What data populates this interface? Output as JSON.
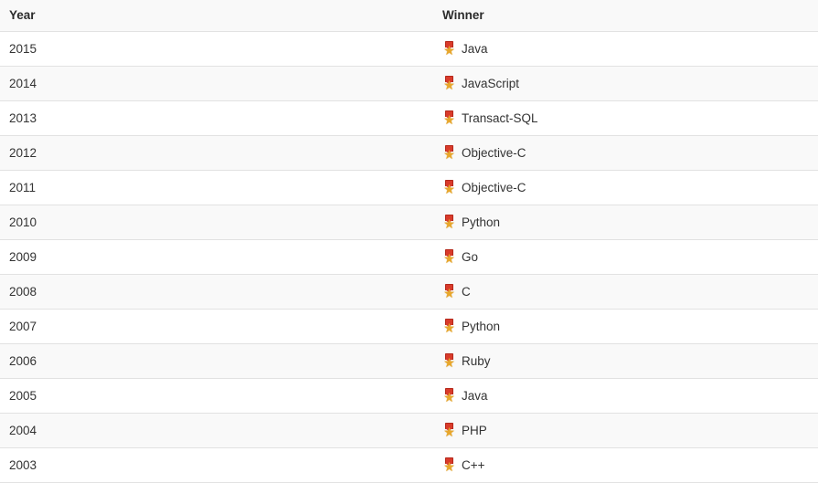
{
  "table": {
    "columns": [
      {
        "key": "year",
        "label": "Year"
      },
      {
        "key": "winner",
        "label": "Winner"
      }
    ],
    "icon": {
      "name": "sports-medal-icon",
      "glyph": "★",
      "ribbon_color": "#d93b2b",
      "medal_color": "#e8a72c"
    },
    "rows": [
      {
        "year": "2015",
        "winner": "Java"
      },
      {
        "year": "2014",
        "winner": "JavaScript"
      },
      {
        "year": "2013",
        "winner": "Transact-SQL"
      },
      {
        "year": "2012",
        "winner": "Objective-C"
      },
      {
        "year": "2011",
        "winner": "Objective-C"
      },
      {
        "year": "2010",
        "winner": "Python"
      },
      {
        "year": "2009",
        "winner": "Go"
      },
      {
        "year": "2008",
        "winner": "C"
      },
      {
        "year": "2007",
        "winner": "Python"
      },
      {
        "year": "2006",
        "winner": "Ruby"
      },
      {
        "year": "2005",
        "winner": "Java"
      },
      {
        "year": "2004",
        "winner": "PHP"
      },
      {
        "year": "2003",
        "winner": "C++"
      }
    ]
  },
  "colors": {
    "header_bg": "#f9f9f9",
    "stripe_bg": "#f9f9f9",
    "row_bg": "#ffffff",
    "border": "#e2e2e2",
    "text": "#333333",
    "header_text": "#2b2b2b"
  },
  "chart_data": {
    "type": "table",
    "title": "",
    "columns": [
      "Year",
      "Winner"
    ],
    "rows": [
      [
        "2015",
        "Java"
      ],
      [
        "2014",
        "JavaScript"
      ],
      [
        "2013",
        "Transact-SQL"
      ],
      [
        "2012",
        "Objective-C"
      ],
      [
        "2011",
        "Objective-C"
      ],
      [
        "2010",
        "Python"
      ],
      [
        "2009",
        "Go"
      ],
      [
        "2008",
        "C"
      ],
      [
        "2007",
        "Python"
      ],
      [
        "2006",
        "Ruby"
      ],
      [
        "2005",
        "Java"
      ],
      [
        "2004",
        "PHP"
      ],
      [
        "2003",
        "C++"
      ]
    ]
  }
}
